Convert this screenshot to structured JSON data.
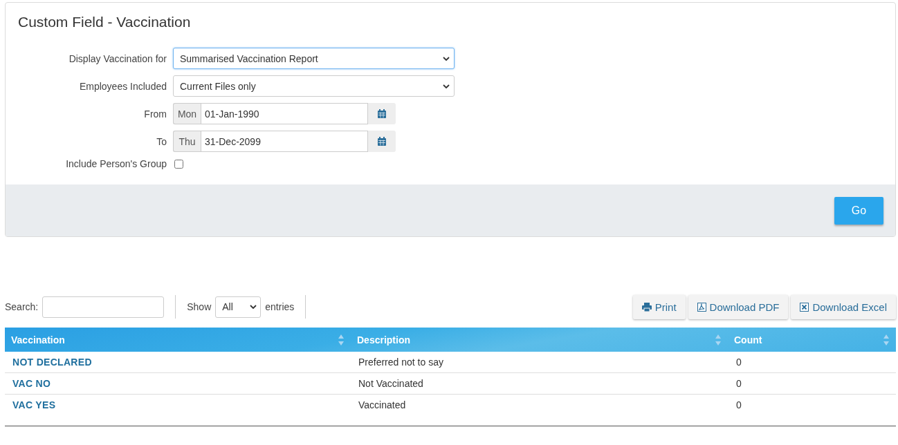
{
  "panel": {
    "title": "Custom Field - Vaccination",
    "fields": [
      {
        "kind": "select",
        "label": "Display Vaccination for",
        "value": "Summarised Vaccination Report",
        "focused": true
      },
      {
        "kind": "select",
        "label": "Employees Included",
        "value": "Current Files only",
        "focused": false
      },
      {
        "kind": "date",
        "label": "From",
        "day": "Mon",
        "value": "01-Jan-1990"
      },
      {
        "kind": "date",
        "label": "To",
        "day": "Thu",
        "value": "31-Dec-2099"
      },
      {
        "kind": "checkbox",
        "label": "Include Person's Group",
        "checked": false
      }
    ],
    "go_button": "Go"
  },
  "toolbar": {
    "search_label": "Search:",
    "show_label": "Show",
    "page_size": "All",
    "entries_label": "entries",
    "buttons": [
      {
        "kind": "print",
        "label": "Print"
      },
      {
        "kind": "pdf",
        "label": "Download PDF"
      },
      {
        "kind": "excel",
        "label": "Download Excel"
      }
    ]
  },
  "table": {
    "columns": [
      "Vaccination",
      "Description",
      "Count"
    ],
    "rows": [
      {
        "vaccination": "NOT DECLARED",
        "description": "Preferred not to say",
        "count": "0"
      },
      {
        "vaccination": "VAC NO",
        "description": "Not Vaccinated",
        "count": "0"
      },
      {
        "vaccination": "VAC YES",
        "description": "Vaccinated",
        "count": "0"
      }
    ]
  }
}
